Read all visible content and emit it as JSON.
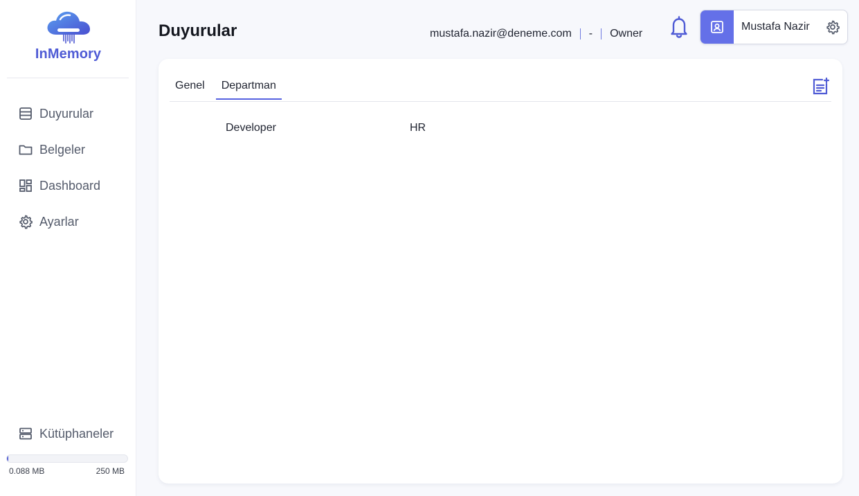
{
  "brand": {
    "name": "InMemory",
    "accent": "#4f5bd5"
  },
  "sidebar": {
    "items": [
      {
        "label": "Duyurular",
        "icon": "list-icon"
      },
      {
        "label": "Belgeler",
        "icon": "folder-icon"
      },
      {
        "label": "Dashboard",
        "icon": "dashboard-icon"
      },
      {
        "label": "Ayarlar",
        "icon": "gear-icon"
      }
    ],
    "libraries_label": "Kütüphaneler",
    "storage": {
      "used": "0.088 MB",
      "total": "250 MB",
      "fraction": 0.00035
    }
  },
  "header": {
    "title": "Duyurular",
    "email": "mustafa.nazir@deneme.com",
    "dash": "-",
    "role": "Owner",
    "user_name": "Mustafa Nazir"
  },
  "main": {
    "tabs": [
      {
        "label": "Genel",
        "active": false
      },
      {
        "label": "Departman",
        "active": true
      }
    ],
    "rows": [
      {
        "position": "Developer",
        "department": "HR"
      }
    ]
  }
}
